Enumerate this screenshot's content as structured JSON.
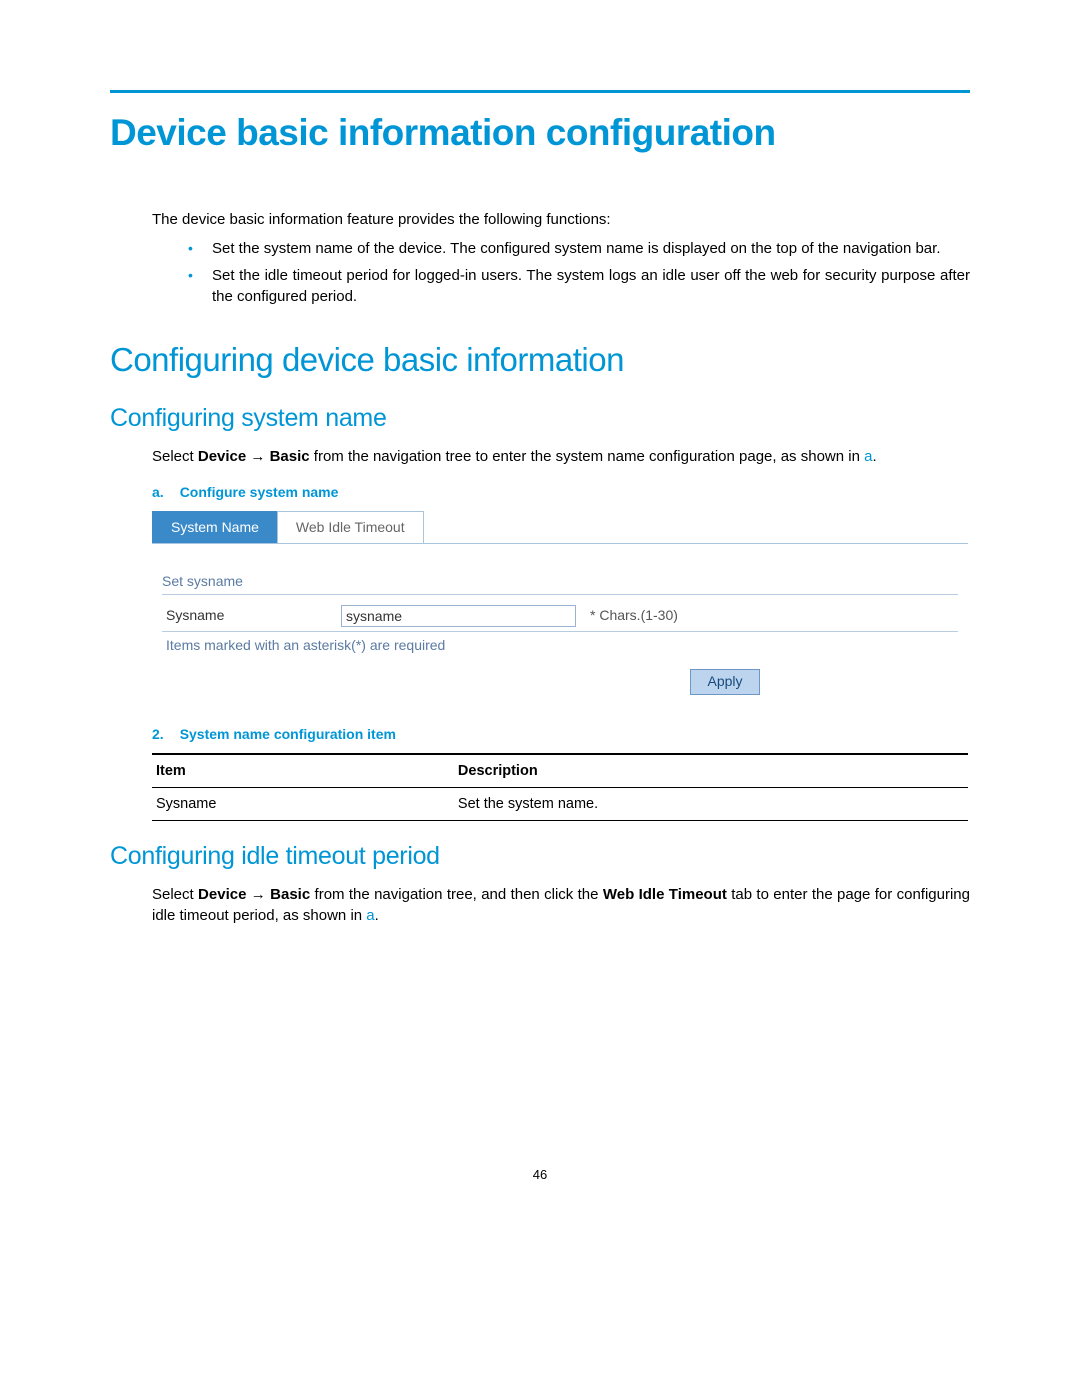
{
  "page": {
    "title": "Device basic information configuration",
    "intro": "The device basic information feature provides the following functions:",
    "bullets": [
      "Set the system name of the device. The configured system name is displayed on the top of the navigation bar.",
      "Set the idle timeout period for logged-in users. The system logs an idle user off the web for security purpose after the configured period."
    ],
    "h2_a": "Configuring device basic information",
    "h3_a": "Configuring system name",
    "para_a_pre": "Select ",
    "para_a_bold1": "Device",
    "para_a_arrow": " → ",
    "para_a_bold2": "Basic",
    "para_a_post": " from the navigation tree to enter the system name configuration page, as shown in ",
    "para_a_ref": "a",
    "para_a_end": ".",
    "fig_a_num": "a.",
    "fig_a_text": "Configure system name",
    "ui": {
      "tab_active": "System Name",
      "tab_other": "Web Idle Timeout",
      "section_label": "Set sysname",
      "field_label": "Sysname",
      "field_value": "sysname",
      "field_hint": "* Chars.(1-30)",
      "required_note": "Items marked with an asterisk(*) are required",
      "apply": "Apply"
    },
    "tbl_cap_num": "2.",
    "tbl_cap_text": "System name configuration item",
    "tbl_head_item": "Item",
    "tbl_head_desc": "Description",
    "tbl_row_item": "Sysname",
    "tbl_row_desc": "Set the system name.",
    "h3_b": "Configuring idle timeout period",
    "para_b_pre": "Select ",
    "para_b_bold1": "Device",
    "para_b_arrow": " → ",
    "para_b_bold2": "Basic",
    "para_b_mid": " from the navigation tree, and then click the ",
    "para_b_bold3": "Web Idle Timeout",
    "para_b_post": " tab to enter the page for configuring idle timeout period, as shown in ",
    "para_b_ref": "a",
    "para_b_end": ".",
    "page_number": "46"
  }
}
